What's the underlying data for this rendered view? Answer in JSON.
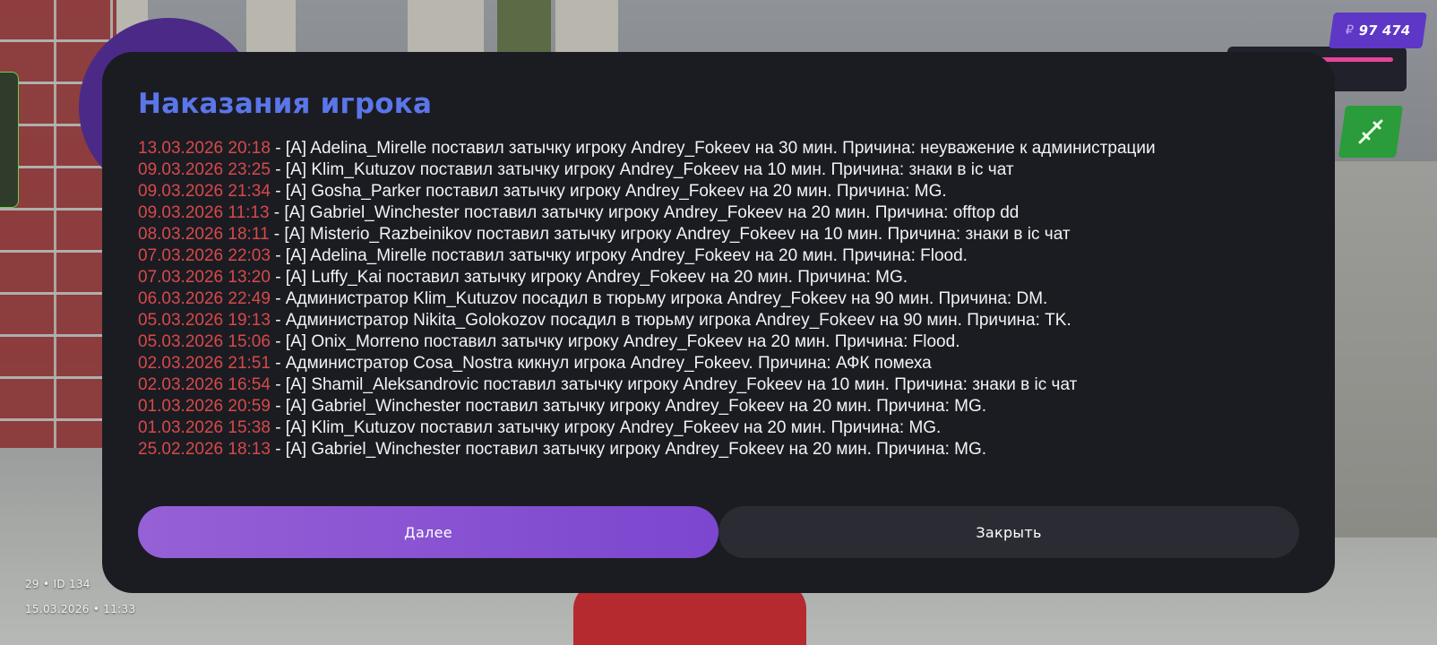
{
  "hud": {
    "money_currency": "₽",
    "money_amount": "97 474",
    "player_info": "29 • ID 134",
    "datetime": "15.03.2026 • 11:33"
  },
  "dialog": {
    "title": "Наказания игрока",
    "entries": [
      {
        "date": "13.03.2026 20:18",
        "text": " - [A] Adelina_Mirelle поставил затычку игроку Andrey_Fokeev на 30 мин. Причина: неуважение к администрации"
      },
      {
        "date": "09.03.2026 23:25",
        "text": " - [A] Klim_Kutuzov поставил затычку игроку Andrey_Fokeev на 10 мин. Причина: знаки в ic чат"
      },
      {
        "date": "09.03.2026 21:34",
        "text": " - [A] Gosha_Parker поставил затычку игроку Andrey_Fokeev на 20 мин. Причина: MG."
      },
      {
        "date": "09.03.2026 11:13",
        "text": " - [A] Gabriel_Winchester поставил затычку игроку Andrey_Fokeev на 20 мин. Причина: offtop dd"
      },
      {
        "date": "08.03.2026 18:11",
        "text": " - [A] Misterio_Razbeinikov поставил затычку игроку Andrey_Fokeev на 10 мин. Причина: знаки в ic чат"
      },
      {
        "date": "07.03.2026 22:03",
        "text": " - [A] Adelina_Mirelle поставил затычку игроку Andrey_Fokeev на 20 мин. Причина: Flood."
      },
      {
        "date": "07.03.2026 13:20",
        "text": " - [A] Luffy_Kai поставил затычку игроку Andrey_Fokeev на 20 мин. Причина: MG."
      },
      {
        "date": "06.03.2026 22:49",
        "text": " - Администратор Klim_Kutuzov посадил в тюрьму игрока Andrey_Fokeev на 90 мин. Причина: DM."
      },
      {
        "date": "05.03.2026 19:13",
        "text": " - Администратор Nikita_Golokozov посадил в тюрьму игрока Andrey_Fokeev на 90 мин. Причина: TK."
      },
      {
        "date": "05.03.2026 15:06",
        "text": " - [A] Onix_Morreno поставил затычку игроку Andrey_Fokeev на 20 мин. Причина: Flood."
      },
      {
        "date": "02.03.2026 21:51",
        "text": " - Администратор Cosa_Nostra кикнул игрока Andrey_Fokeev. Причина: АФК помеха"
      },
      {
        "date": "02.03.2026 16:54",
        "text": " - [A] Shamil_Aleksandrovic поставил затычку игроку Andrey_Fokeev на 10 мин. Причина: знаки в ic чат"
      },
      {
        "date": "01.03.2026 20:59",
        "text": " - [A] Gabriel_Winchester поставил затычку игроку Andrey_Fokeev на 20 мин. Причина: MG."
      },
      {
        "date": "01.03.2026 15:38",
        "text": " - [A] Klim_Kutuzov поставил затычку игроку Andrey_Fokeev на 20 мин. Причина: MG."
      },
      {
        "date": "25.02.2026 18:13",
        "text": " - [A] Gabriel_Winchester поставил затычку игроку Andrey_Fokeev на 20 мин. Причина: MG."
      }
    ],
    "next_label": "Далее",
    "close_label": "Закрыть"
  },
  "colors": {
    "title": "#5b76ea",
    "date": "#d7494a",
    "dialog_bg": "#1b1c22",
    "next_button": "#8a52d4",
    "close_button": "#2b2c33",
    "money_badge": "#5e37c6",
    "weapon_badge": "#2a9c3a"
  },
  "icons": {
    "weapon": "rifle-icon"
  }
}
